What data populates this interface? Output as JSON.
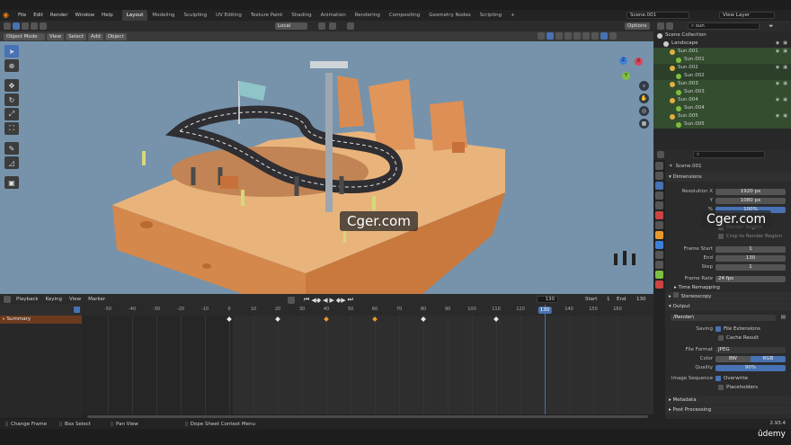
{
  "menubar": {
    "items": [
      "File",
      "Edit",
      "Render",
      "Window",
      "Help"
    ],
    "workspaces": [
      "Layout",
      "Modeling",
      "Sculpting",
      "UV Editing",
      "Texture Paint",
      "Shading",
      "Animation",
      "Rendering",
      "Compositing",
      "Geometry Nodes",
      "Scripting"
    ],
    "active_workspace": "Layout",
    "add_tab": "+",
    "scene_name": "Scene.001",
    "view_layer": "View Layer"
  },
  "viewport_header": {
    "mode": "Object Mode",
    "menus": [
      "View",
      "Select",
      "Add",
      "Object"
    ],
    "transform_orientation": "Local",
    "options": "Options"
  },
  "viewport": {
    "axis_labels": [
      "X",
      "Y",
      "Z"
    ],
    "watermark_left": "Cger.com",
    "watermark_right": "Cger.com"
  },
  "timeline": {
    "menus": [
      "Playback",
      "Keying",
      "View",
      "Marker"
    ],
    "current_frame": "130",
    "start_label": "Start",
    "start_value": "1",
    "end_label": "End",
    "end_value": "130",
    "summary_label": "Summary",
    "ruler": [
      -50,
      -40,
      -30,
      -20,
      -10,
      0,
      10,
      20,
      30,
      40,
      50,
      60,
      70,
      80,
      90,
      100,
      110,
      120,
      130,
      140,
      150,
      160
    ],
    "keyframes_white": [
      0,
      20,
      80,
      110
    ],
    "keyframes_orange": [
      40,
      60
    ],
    "playhead_value": 130
  },
  "statusbar": {
    "items": [
      "Change Frame",
      "Box Select",
      "Pan View",
      "Dope Sheet Context Menu"
    ],
    "version": "2.93.4"
  },
  "outliner": {
    "search_placeholder": "sun",
    "rows": [
      {
        "label": "Scene Collection",
        "indent": 0,
        "style": "normal"
      },
      {
        "label": "Landscape",
        "indent": 1,
        "style": "normal"
      },
      {
        "label": "Sun.001",
        "indent": 2,
        "style": "sel"
      },
      {
        "label": "Sun.001",
        "indent": 3,
        "style": "sel"
      },
      {
        "label": "Sun.002",
        "indent": 2,
        "style": "sel2"
      },
      {
        "label": "Sun.002",
        "indent": 3,
        "style": "sel2"
      },
      {
        "label": "Sun.003",
        "indent": 2,
        "style": "sel"
      },
      {
        "label": "Sun.003",
        "indent": 3,
        "style": "sel"
      },
      {
        "label": "Sun.004",
        "indent": 2,
        "style": "sel"
      },
      {
        "label": "Sun.004",
        "indent": 3,
        "style": "sel"
      },
      {
        "label": "Sun.005",
        "indent": 2,
        "style": "sel"
      },
      {
        "label": "Sun.005",
        "indent": 3,
        "style": "sel"
      }
    ]
  },
  "properties": {
    "scene_name": "Scene.001",
    "dimensions_label": "Dimensions",
    "resolution_x_label": "Resolution X",
    "resolution_x": "1920 px",
    "resolution_y_label": "Y",
    "resolution_y": "1080 px",
    "resolution_pct_label": "%",
    "resolution_pct": "100%",
    "render_region": "Render Region",
    "crop_region": "Crop to Render Region",
    "frame_start_label": "Frame Start",
    "frame_start": "1",
    "frame_end_label": "End",
    "frame_end": "130",
    "frame_step_label": "Step",
    "frame_step": "1",
    "frame_rate_label": "Frame Rate",
    "frame_rate": "24 fps",
    "time_remapping": "Time Remapping",
    "stereoscopy": "Stereoscopy",
    "output_label": "Output",
    "output_path": "/Render\\",
    "saving_label": "Saving",
    "file_extensions": "File Extensions",
    "cache_result": "Cache Result",
    "file_format_label": "File Format",
    "file_format": "JPEG",
    "color_label": "Color",
    "color_bw": "BW",
    "color_rgb": "RGB",
    "quality_label": "Quality",
    "quality": "90%",
    "image_sequence_label": "Image Sequence",
    "overwrite": "Overwrite",
    "placeholders": "Placeholders",
    "metadata": "Metadata",
    "post_processing": "Post Processing"
  },
  "branding": {
    "udemy": "ûdemy"
  },
  "colors": {
    "accent": "#4772b3",
    "viewport_bg": "#7693ab",
    "keyframe_orange": "#e69a2e",
    "playhead": "#4772b3"
  }
}
